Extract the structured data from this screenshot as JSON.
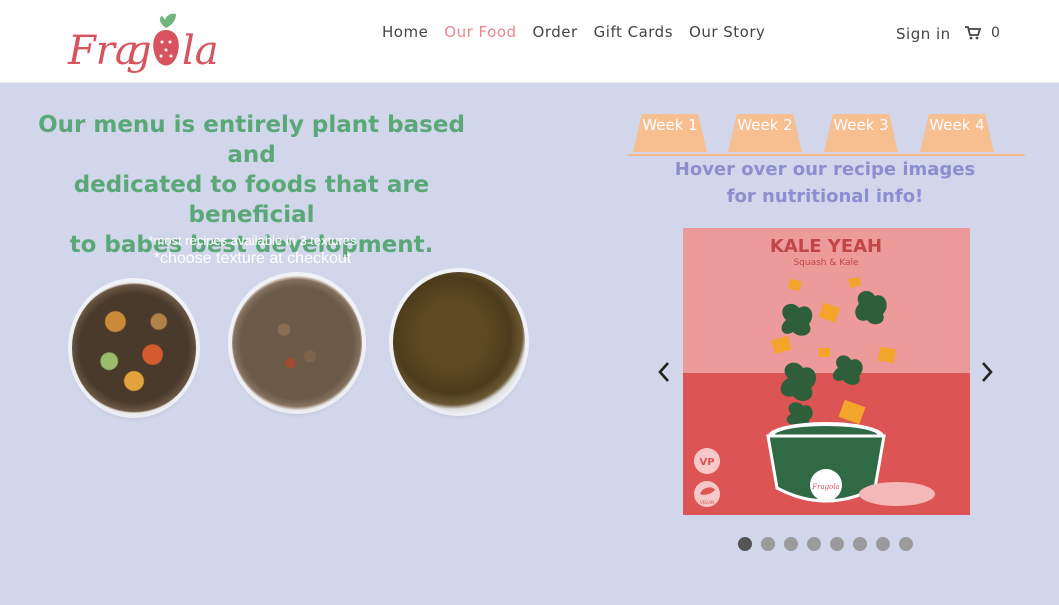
{
  "brand": {
    "logo_text": "Fragola"
  },
  "nav": {
    "items": [
      {
        "label": "Home",
        "active": false
      },
      {
        "label": "Our Food",
        "active": true
      },
      {
        "label": "Order",
        "active": false
      },
      {
        "label": "Gift Cards",
        "active": false
      },
      {
        "label": "Our Story",
        "active": false
      }
    ],
    "sign_in": "Sign in",
    "cart_count": "0"
  },
  "main": {
    "headline_line1": "Our menu is entirely plant based and",
    "headline_line2": "dedicated to foods that are beneficial",
    "headline_line3": "to babes best development.",
    "note_textures": "*most recipes available in 3 textures",
    "note_checkout": "*choose texture at checkout"
  },
  "weeks": {
    "tabs": [
      "Week 1",
      "Week 2",
      "Week 3",
      "Week 4"
    ],
    "hover_line1": "Hover over our recipe images",
    "hover_line2": "for nutritional info!"
  },
  "recipe": {
    "name": "KALE YEAH",
    "subtitle": "Squash & Kale",
    "badge_vp": "VP",
    "badge_vegan": "VEGAN",
    "jar_logo": "Fragola"
  },
  "carousel": {
    "total_slides": 8,
    "active_index": 0
  },
  "colors": {
    "page_bg": "#d2d6ea",
    "accent_green": "#5aa878",
    "nav_active": "#e8868f",
    "tab_orange": "#f7bf90",
    "hover_text": "#8b8fcf",
    "recipe_top": "#ec9a9a",
    "recipe_bottom": "#dc5554"
  }
}
